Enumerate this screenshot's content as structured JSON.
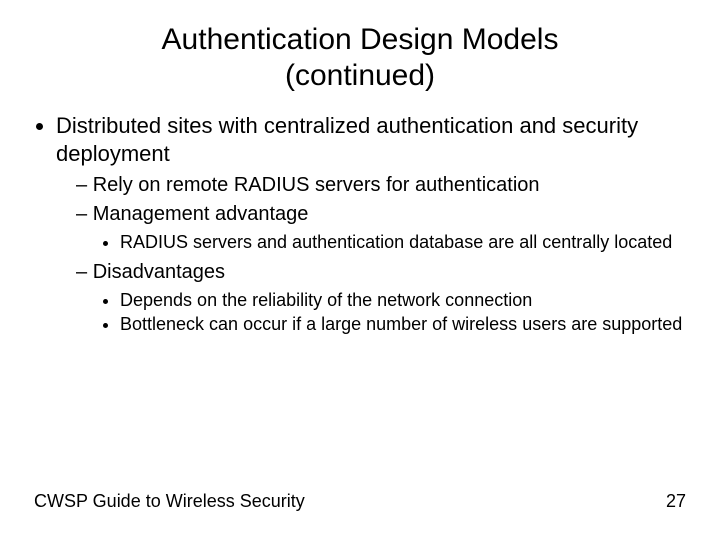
{
  "title_line1": "Authentication Design Models",
  "title_line2": "(continued)",
  "bullets": {
    "b1": "Distributed sites with centralized authentication and security deployment",
    "b1_1": "Rely on remote RADIUS servers for authentication",
    "b1_2": "Management advantage",
    "b1_2_1": "RADIUS servers and authentication database are all centrally located",
    "b1_3": "Disadvantages",
    "b1_3_1": "Depends on the reliability of the network connection",
    "b1_3_2": "Bottleneck can occur if a large number of wireless users are supported"
  },
  "footer_left": "CWSP Guide to Wireless Security",
  "footer_right": "27"
}
